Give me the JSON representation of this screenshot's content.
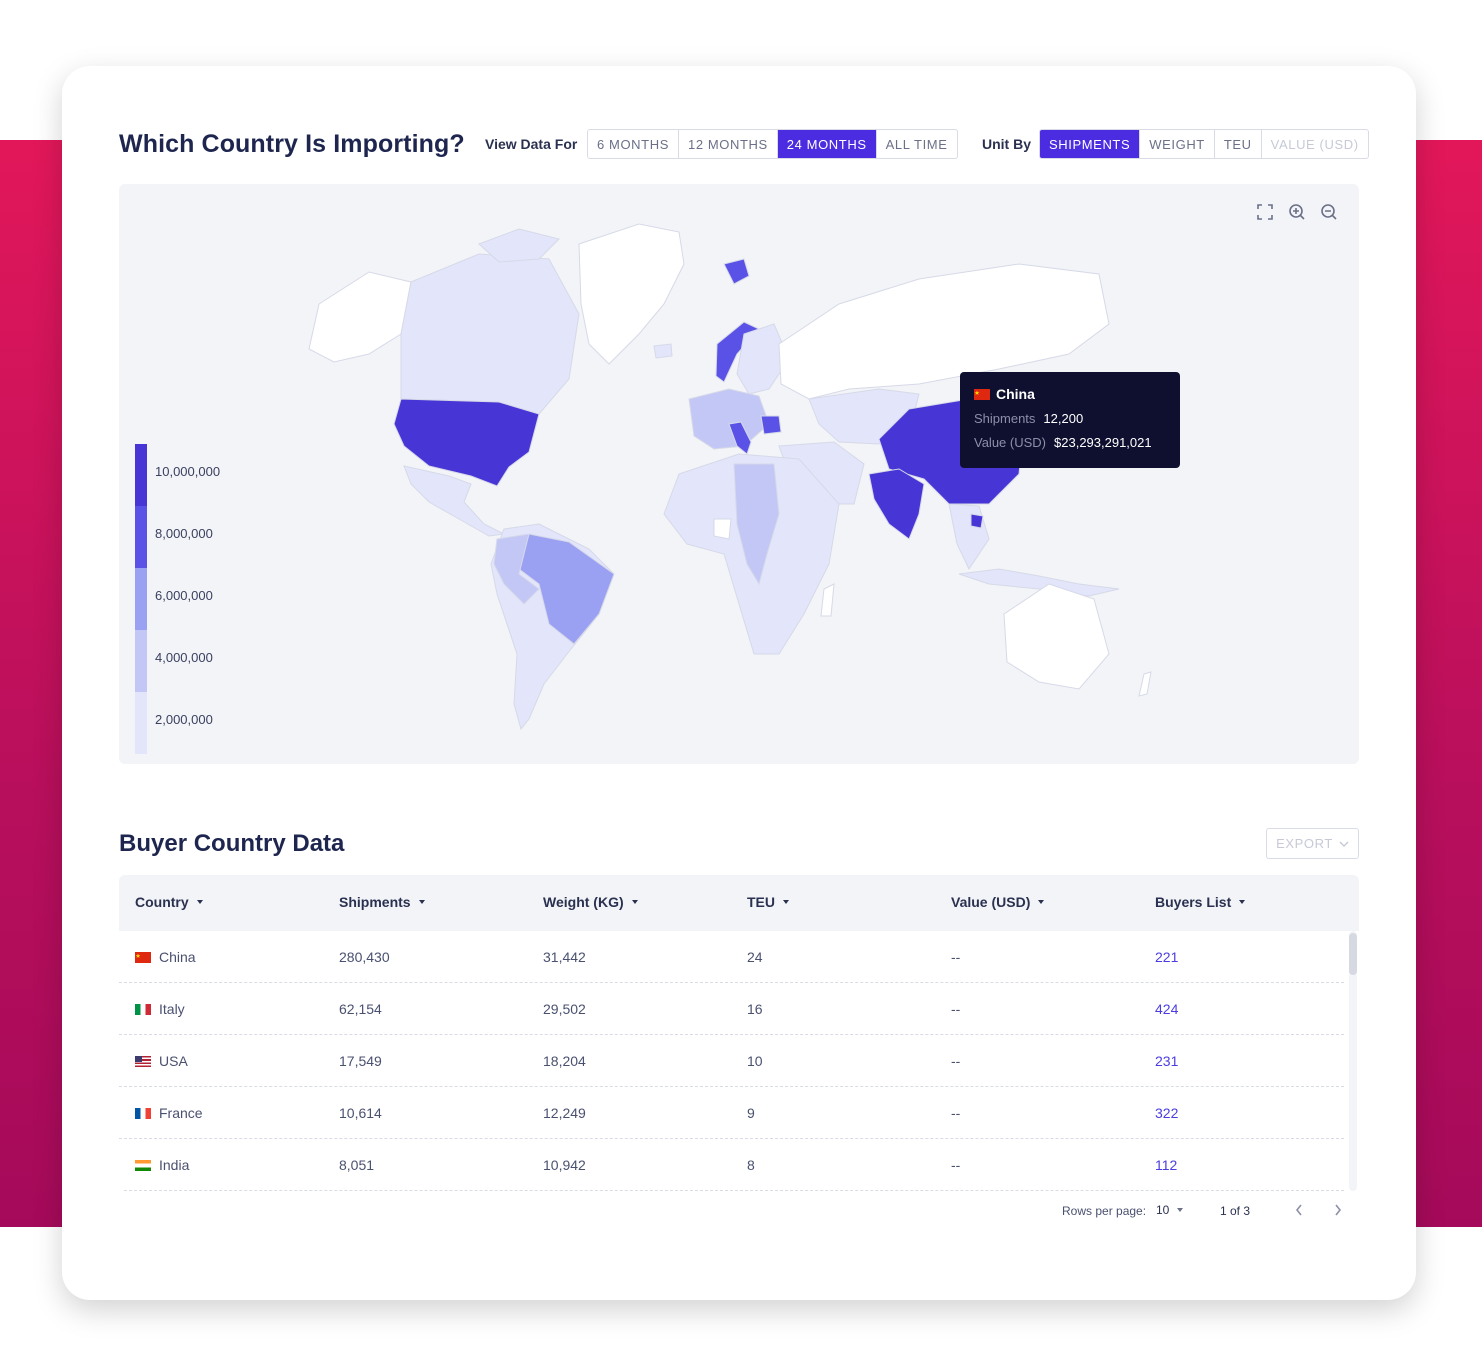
{
  "colors": {
    "accent": "#4b2ce0",
    "band": "#e2175a",
    "tooltip_bg": "#0f1030",
    "link": "#4b3de0"
  },
  "map_section": {
    "title": "Which Country Is Importing?",
    "view_label": "View Data For",
    "periods": [
      "6 MONTHS",
      "12 MONTHS",
      "24 MONTHS",
      "ALL TIME"
    ],
    "selected_period": "24 MONTHS",
    "unit_label": "Unit By",
    "units": [
      "SHIPMENTS",
      "WEIGHT",
      "TEU",
      "VALUE (USD)"
    ],
    "selected_unit": "SHIPMENTS",
    "disabled_unit": "VALUE (USD)",
    "tools": [
      "fullscreen-icon",
      "zoom-in-icon",
      "zoom-out-icon"
    ],
    "legend": [
      "10,000,000",
      "8,000,000",
      "6,000,000",
      "4,000,000",
      "2,000,000"
    ],
    "legend_colors": [
      "#4835d6",
      "#5a52e6",
      "#9aa0f2",
      "#c3c7f5",
      "#e3e5fb"
    ],
    "tooltip": {
      "country": "China",
      "rows": [
        {
          "key": "Shipments",
          "value": "12,200"
        },
        {
          "key": "Value (USD)",
          "value": "$23,293,291,021"
        }
      ]
    }
  },
  "table_section": {
    "title": "Buyer Country Data",
    "export_label": "EXPORT",
    "columns": [
      "Country",
      "Shipments",
      "Weight (KG)",
      "TEU",
      "Value (USD)",
      "Buyers List"
    ],
    "rows": [
      {
        "country": "China",
        "flag": "cn",
        "shipments": "280,430",
        "weight": "31,442",
        "teu": "24",
        "value": "--",
        "buyers": "221"
      },
      {
        "country": "Italy",
        "flag": "it",
        "shipments": "62,154",
        "weight": "29,502",
        "teu": "16",
        "value": "--",
        "buyers": "424"
      },
      {
        "country": "USA",
        "flag": "us",
        "shipments": "17,549",
        "weight": "18,204",
        "teu": "10",
        "value": "--",
        "buyers": "231"
      },
      {
        "country": "France",
        "flag": "fr",
        "shipments": "10,614",
        "weight": "12,249",
        "teu": "9",
        "value": "--",
        "buyers": "322"
      },
      {
        "country": "India",
        "flag": "in",
        "shipments": "8,051",
        "weight": "10,942",
        "teu": "8",
        "value": "--",
        "buyers": "112"
      }
    ],
    "pagination": {
      "rows_label": "Rows per page:",
      "rows_value": "10",
      "page_text": "1 of 3"
    }
  }
}
